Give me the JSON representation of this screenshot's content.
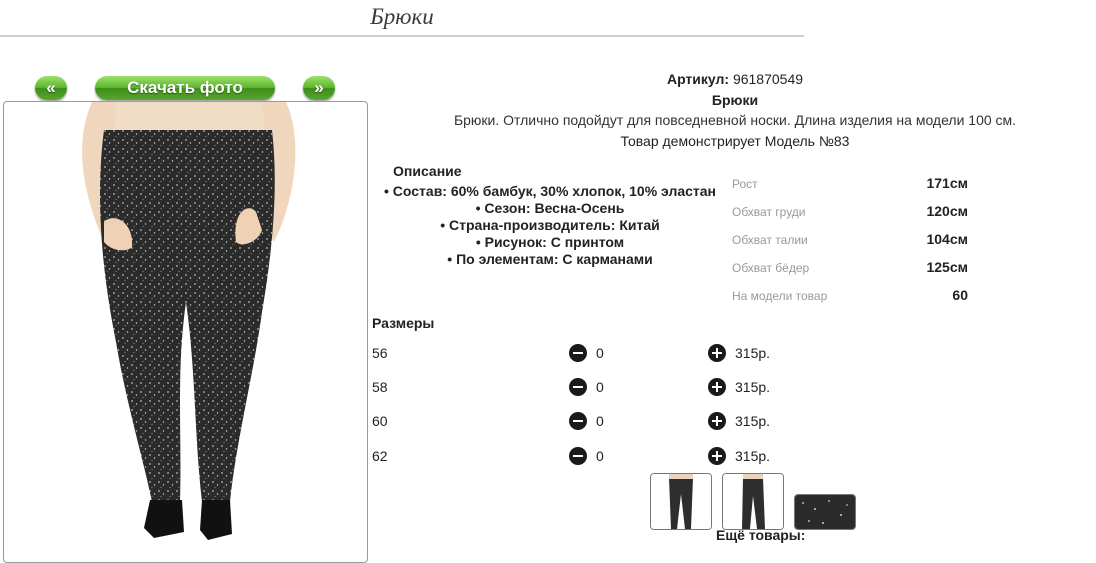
{
  "page": {
    "title": "Брюки"
  },
  "gallery": {
    "prev_label": "«",
    "download_label": "Скачать фото",
    "next_label": "»"
  },
  "product": {
    "article_label": "Артикул:",
    "article_value": "961870549",
    "name": "Брюки",
    "description": "Брюки. Отлично подойдут для повседневной носки. Длина изделия на модели 100 см.",
    "model_note": "Товар демонстрирует Модель №83"
  },
  "details": {
    "title": "Описание",
    "items": [
      "Состав: 60% бамбук, 30% хлопок, 10% эластан",
      "Сезон: Весна-Осень",
      "Страна-производитель: Китай",
      "Рисунок: С принтом",
      "По элементам: С карманами"
    ]
  },
  "measurements": [
    {
      "label": "Рост",
      "value": "171см"
    },
    {
      "label": "Обхват груди",
      "value": "120см"
    },
    {
      "label": "Обхват талии",
      "value": "104см"
    },
    {
      "label": "Обхват бёдер",
      "value": "125см"
    },
    {
      "label": "На модели товар",
      "value": "60"
    }
  ],
  "sizes": {
    "title": "Размеры",
    "rows": [
      {
        "size": "56",
        "qty": "0",
        "price": "315р."
      },
      {
        "size": "58",
        "qty": "0",
        "price": "315р."
      },
      {
        "size": "60",
        "qty": "0",
        "price": "315р."
      },
      {
        "size": "62",
        "qty": "0",
        "price": "315р."
      }
    ]
  },
  "more": {
    "title": "Ещё товары:"
  },
  "icons": {
    "minus": "minus-circle-icon",
    "plus": "plus-circle-icon"
  },
  "colors": {
    "button_green": "#5fb52f",
    "fabric": "#2e2e2e"
  }
}
